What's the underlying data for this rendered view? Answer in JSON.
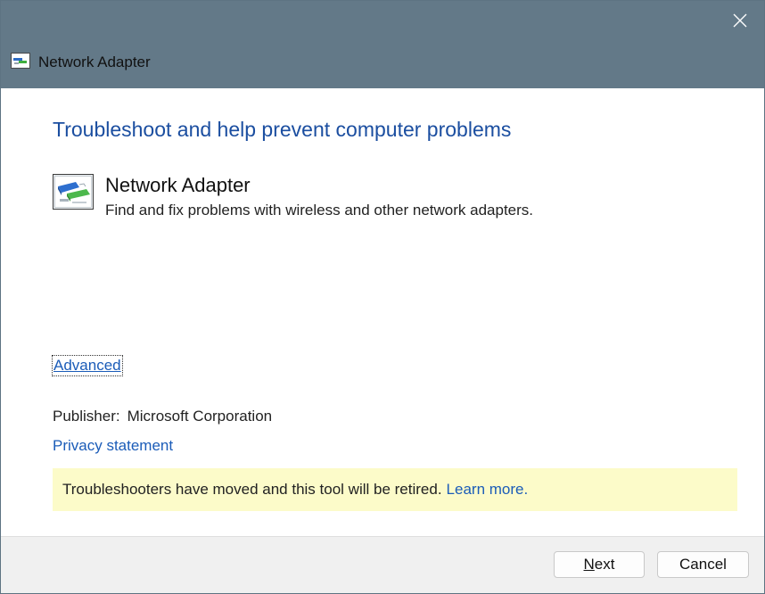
{
  "window": {
    "title": "Network Adapter"
  },
  "content": {
    "heading": "Troubleshoot and help prevent computer problems",
    "tool": {
      "name": "Network Adapter",
      "description": "Find and fix problems with wireless and other network adapters.",
      "icon": "network-adapter-icon"
    },
    "advanced_label": "Advanced",
    "publisher": {
      "label": "Publisher:",
      "value": "Microsoft Corporation"
    },
    "privacy_label": "Privacy statement",
    "notice": {
      "text": "Troubleshooters have moved and this tool will be retired.",
      "link_label": "Learn more."
    }
  },
  "footer": {
    "next_mnemonic": "N",
    "next_rest": "ext",
    "cancel_label": "Cancel"
  },
  "colors": {
    "titlebar": "#637988",
    "heading": "#1b4ea0",
    "link": "#1b5cb8",
    "notice_bg": "#fcfbc9",
    "footer_bg": "#f0f0f0"
  }
}
